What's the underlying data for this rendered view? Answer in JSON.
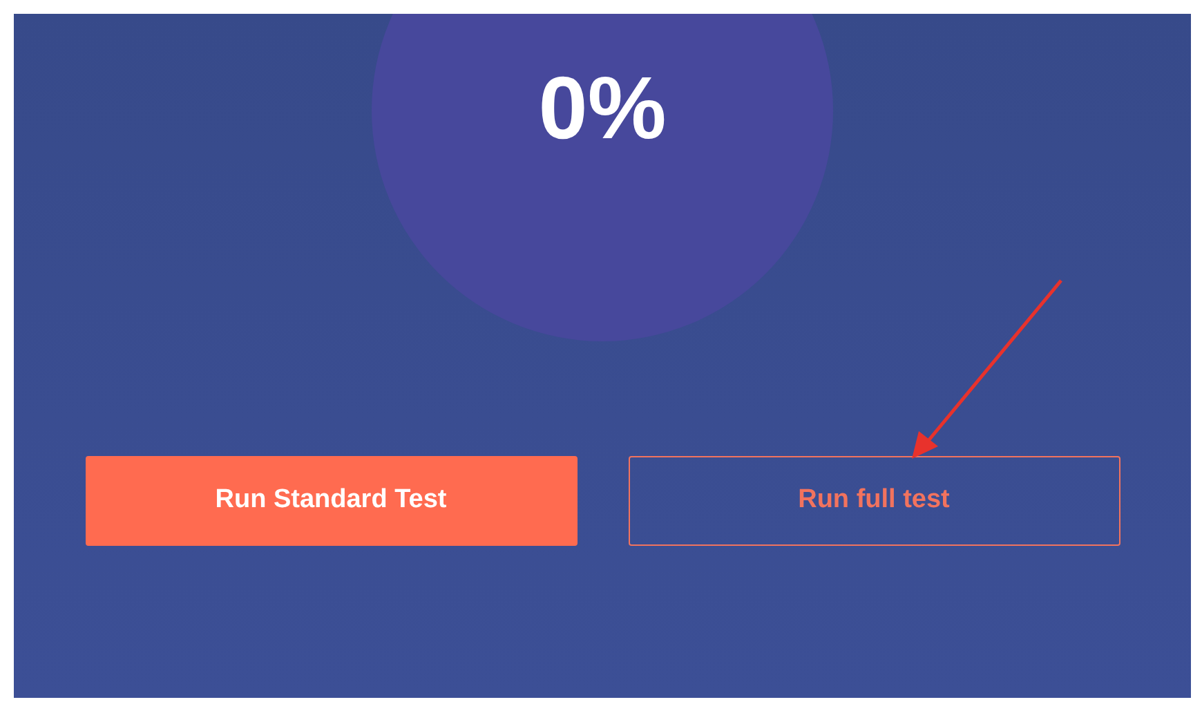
{
  "progress": "0%",
  "buttons": [
    {
      "label": "Run Standard Test",
      "kind": "primary"
    },
    {
      "label": "Run full test",
      "kind": "outline"
    }
  ]
}
